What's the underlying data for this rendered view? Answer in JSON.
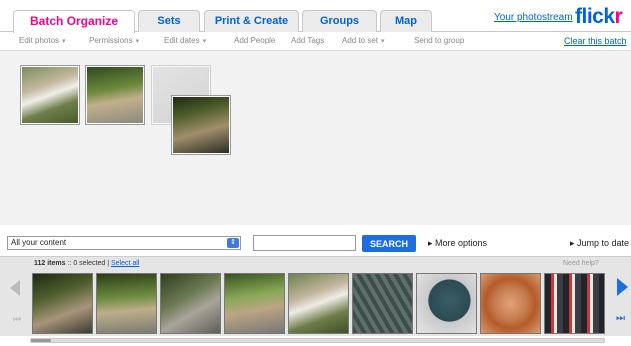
{
  "tabs": [
    {
      "label": "Batch Organize"
    },
    {
      "label": "Sets"
    },
    {
      "label": "Print & Create"
    },
    {
      "label": "Groups"
    },
    {
      "label": "Map"
    }
  ],
  "header": {
    "stream_link": "Your photostream",
    "logo_part1": "flick",
    "logo_part2": "r"
  },
  "toolbar": {
    "items": [
      {
        "label": "Edit photos"
      },
      {
        "label": "Permissions"
      },
      {
        "label": "Edit dates"
      },
      {
        "label": "Add People"
      },
      {
        "label": "Add Tags"
      },
      {
        "label": "Add to set"
      },
      {
        "label": "Send to group"
      }
    ],
    "clear_label": "Clear this batch"
  },
  "search": {
    "select_value": "All your content",
    "input_value": "",
    "button_label": "SEARCH",
    "more_options": "More options",
    "jump_to": "Jump to date"
  },
  "status": {
    "items_count": "112 items",
    "separator": "::",
    "selected_text": "0 selected",
    "select_all": "Select all",
    "need_help": "Need help?"
  },
  "colors": {
    "accent_blue": "#0063dc",
    "accent_pink": "#ff0084",
    "button_blue": "#1e6fde"
  }
}
